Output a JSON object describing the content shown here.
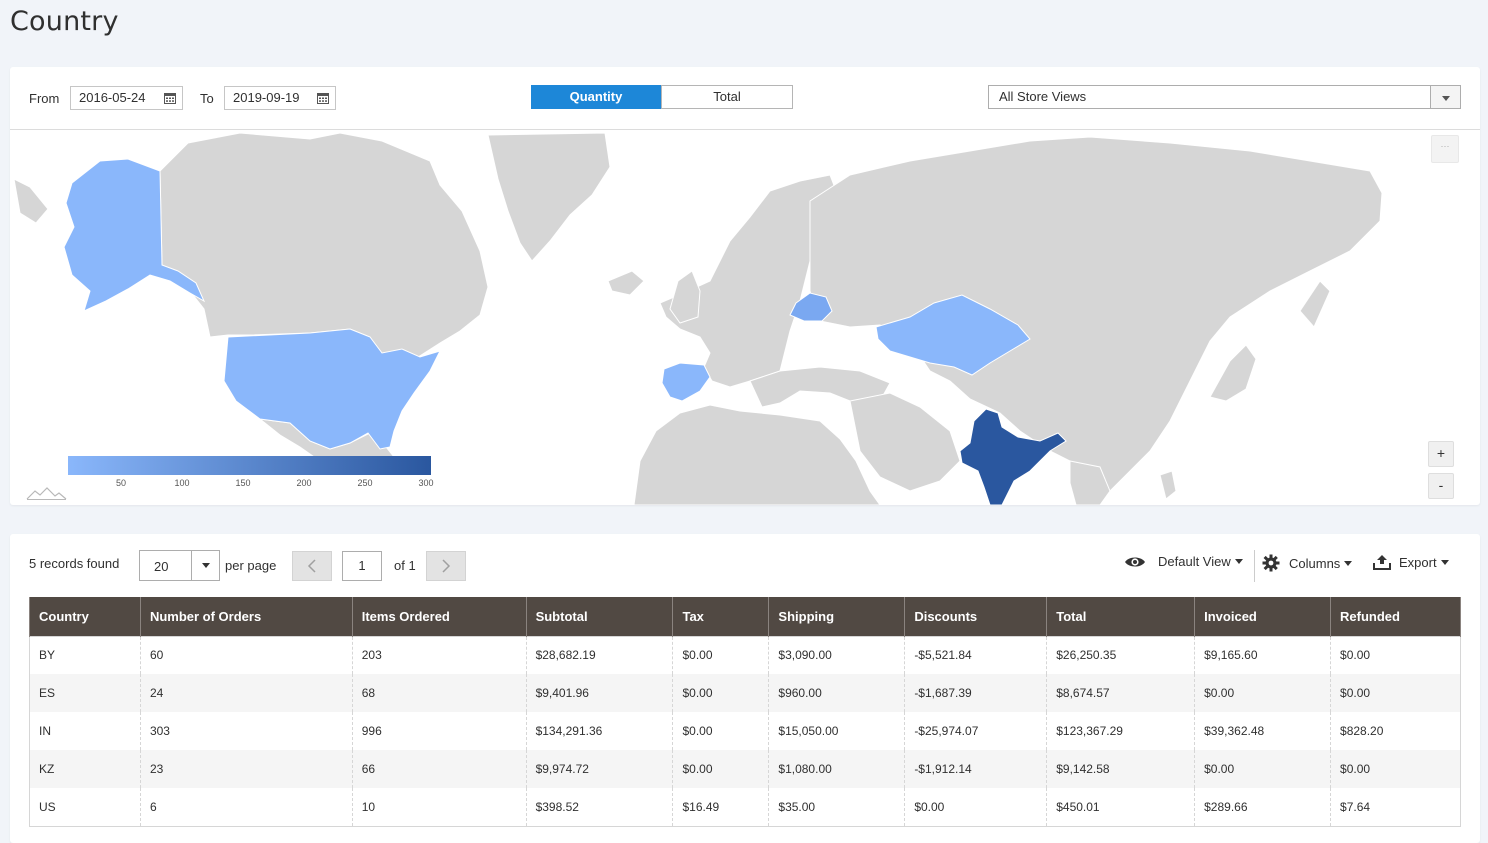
{
  "page": {
    "title": "Country"
  },
  "filters": {
    "from_label": "From",
    "from_value": "2016-05-24",
    "to_label": "To",
    "to_value": "2019-09-19",
    "toggle": {
      "quantity": "Quantity",
      "total": "Total",
      "active": "Quantity"
    },
    "store_view": "All Store Views"
  },
  "map": {
    "highlighted_countries": [
      {
        "code": "US",
        "color": "#8ab7fb"
      },
      {
        "code": "BY",
        "color": "#7aa8f1"
      },
      {
        "code": "ES",
        "color": "#8ab7fb"
      },
      {
        "code": "KZ",
        "color": "#8ab7fb"
      },
      {
        "code": "IN",
        "color": "#2a579f"
      }
    ],
    "base_color": "#d6d6d6",
    "legend": {
      "ticks": [
        "50",
        "100",
        "150",
        "200",
        "250",
        "300"
      ],
      "min_color": "#8ab7fb",
      "max_color": "#2a579f"
    },
    "zoom_in": "+",
    "zoom_out": "-",
    "menu": "···"
  },
  "grid": {
    "records_found": "5 records found",
    "per_page_value": "20",
    "per_page_label": "per page",
    "page_value": "1",
    "page_of": "of 1",
    "default_view": "Default View",
    "columns": "Columns",
    "export": "Export",
    "headers": [
      "Country",
      "Number of Orders",
      "Items Ordered",
      "Subtotal",
      "Tax",
      "Shipping",
      "Discounts",
      "Total",
      "Invoiced",
      "Refunded"
    ],
    "rows": [
      [
        "BY",
        "60",
        "203",
        "$28,682.19",
        "$0.00",
        "$3,090.00",
        "-$5,521.84",
        "$26,250.35",
        "$9,165.60",
        "$0.00"
      ],
      [
        "ES",
        "24",
        "68",
        "$9,401.96",
        "$0.00",
        "$960.00",
        "-$1,687.39",
        "$8,674.57",
        "$0.00",
        "$0.00"
      ],
      [
        "IN",
        "303",
        "996",
        "$134,291.36",
        "$0.00",
        "$15,050.00",
        "-$25,974.07",
        "$123,367.29",
        "$39,362.48",
        "$828.20"
      ],
      [
        "KZ",
        "23",
        "66",
        "$9,974.72",
        "$0.00",
        "$1,080.00",
        "-$1,912.14",
        "$9,142.58",
        "$0.00",
        "$0.00"
      ],
      [
        "US",
        "6",
        "10",
        "$398.52",
        "$16.49",
        "$35.00",
        "$0.00",
        "$450.01",
        "$289.66",
        "$7.64"
      ]
    ]
  }
}
